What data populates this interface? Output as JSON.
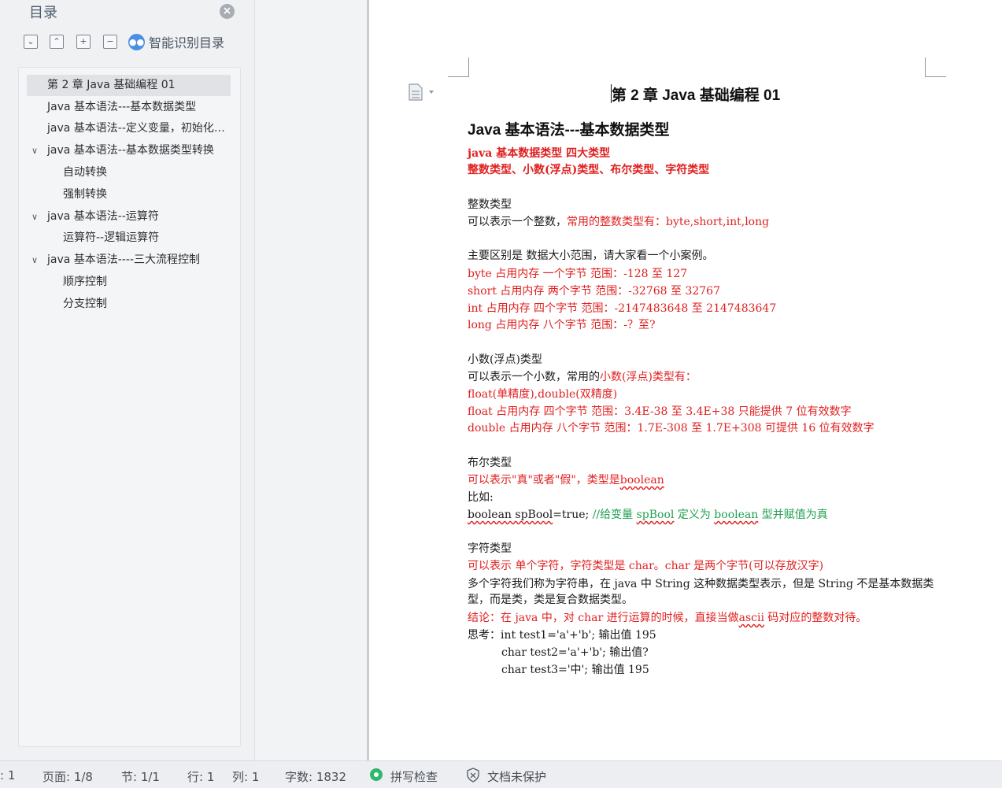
{
  "toc": {
    "title": "目录",
    "smart_label": "智能识别目录",
    "items": [
      {
        "label": "第 2 章 Java 基础编程 01",
        "level": 0,
        "selected": true,
        "expanded": null
      },
      {
        "label": "Java 基本语法---基本数据类型",
        "level": 0,
        "selected": false,
        "expanded": null
      },
      {
        "label": "java 基本语法--定义变量，初始化，赋值",
        "level": 0,
        "selected": false,
        "expanded": null
      },
      {
        "label": "java 基本语法--基本数据类型转换",
        "level": 0,
        "selected": false,
        "expanded": true
      },
      {
        "label": "自动转换",
        "level": 1,
        "selected": false,
        "expanded": null
      },
      {
        "label": "强制转换",
        "level": 1,
        "selected": false,
        "expanded": null
      },
      {
        "label": "java  基本语法--运算符",
        "level": 0,
        "selected": false,
        "expanded": true
      },
      {
        "label": "运算符--逻辑运算符",
        "level": 1,
        "selected": false,
        "expanded": null
      },
      {
        "label": "java 基本语法----三大流程控制",
        "level": 0,
        "selected": false,
        "expanded": true
      },
      {
        "label": "顺序控制",
        "level": 1,
        "selected": false,
        "expanded": null
      },
      {
        "label": "分支控制",
        "level": 1,
        "selected": false,
        "expanded": null
      }
    ]
  },
  "doc": {
    "title": "第 2 章 Java 基础编程 01",
    "heading": "Java 基本语法---基本数据类型",
    "l1": "java 基本数据类型  四大类型",
    "l2": "整数类型、小数(浮点)类型、布尔类型、字符类型",
    "l3": "整数类型",
    "l4a": "可以表示一个整数，",
    "l4b": "常用的整数类型有：byte,short,int,long",
    "l5": "主要区别是  数据大小范围，请大家看一个小案例。",
    "l6": "byte    占用内存  一个字节  范围：-128 至 127",
    "l7": "short  占用内存  两个字节  范围：-32768 至 32767",
    "l8": "int      占用内存  四个字节  范围：-2147483648 至 2147483647",
    "l9": "long    占用内存  八个字节  范围：-？至?",
    "l10": "小数(浮点)类型",
    "l11a": "可以表示一个小数，常用的",
    "l11b": "小数(浮点)类型有：",
    "l12": "float(单精度),double(双精度)",
    "l13": "float  占用内存  四个字节  范围：3.4E-38 至 3.4E+38  只能提供 7 位有效数字",
    "l14": "double 占用内存  八个字节  范围：1.7E-308 至 1.7E+308  可提供 16 位有效数字",
    "l15": "布尔类型",
    "l16a": "可以表示\"真\"或者\"假\"，类型是",
    "l16b": "boolean",
    "l17": "比如:",
    "l18a": "boolean",
    "l18b": " spBool",
    "l18c": "=true; ",
    "l18d": "//给变量 ",
    "l18e": "spBool",
    "l18f": " 定义为 ",
    "l18g": "boolean",
    "l18h": " 型并赋值为真",
    "l19": "字符类型",
    "l20": "可以表示  单个字符，字符类型是 char。char 是两个字节(可以存放汉字)",
    "l21": "多个字符我们称为字符串，在 java 中 String 这种数据类型表示，但是 String 不是基本数据类",
    "l22": "型，而是类，类是复合数据类型。",
    "l23a": "结论：在 java 中，对 char 进行运算的时候，直接当做",
    "l23b": "ascii",
    "l23c": " 码对应的整数对待。",
    "l24": "思考：int test1='a'+'b';   输出值 195",
    "l25": "char test2='a'+'b';  输出值?",
    "l26": "char test3='中';       输出值 195"
  },
  "status": {
    "section_partial": ": 1",
    "page": "页面: 1/8",
    "section": "节: 1/1",
    "row": "行: 1",
    "col": "列: 1",
    "words": "字数: 1832",
    "spell": "拼写检查",
    "protect": "文档未保护"
  },
  "colors": {
    "accent_red": "#e02020",
    "comment_green": "#20a050",
    "smart_blue": "#4a90e2"
  }
}
